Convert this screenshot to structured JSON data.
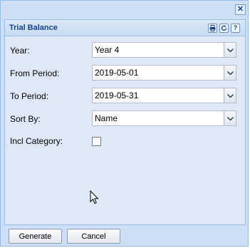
{
  "window": {
    "close_icon": "close-icon"
  },
  "panel": {
    "title": "Trial Balance",
    "tools": [
      "print-icon",
      "refresh-icon",
      "help-icon"
    ],
    "help_glyph": "?"
  },
  "form": {
    "year": {
      "label": "Year:",
      "value": "Year 4"
    },
    "from_period": {
      "label": "From Period:",
      "value": "2019-05-01"
    },
    "to_period": {
      "label": "To Period:",
      "value": "2019-05-31"
    },
    "sort_by": {
      "label": "Sort By:",
      "value": "Name"
    },
    "incl_category": {
      "label": "Incl Category:",
      "checked": false
    }
  },
  "buttons": {
    "generate": "Generate",
    "cancel": "Cancel"
  },
  "colors": {
    "window_bg": "#cedff5",
    "panel_bg": "#dfe8f6",
    "title_color": "#15428b",
    "border": "#99bbe8"
  }
}
